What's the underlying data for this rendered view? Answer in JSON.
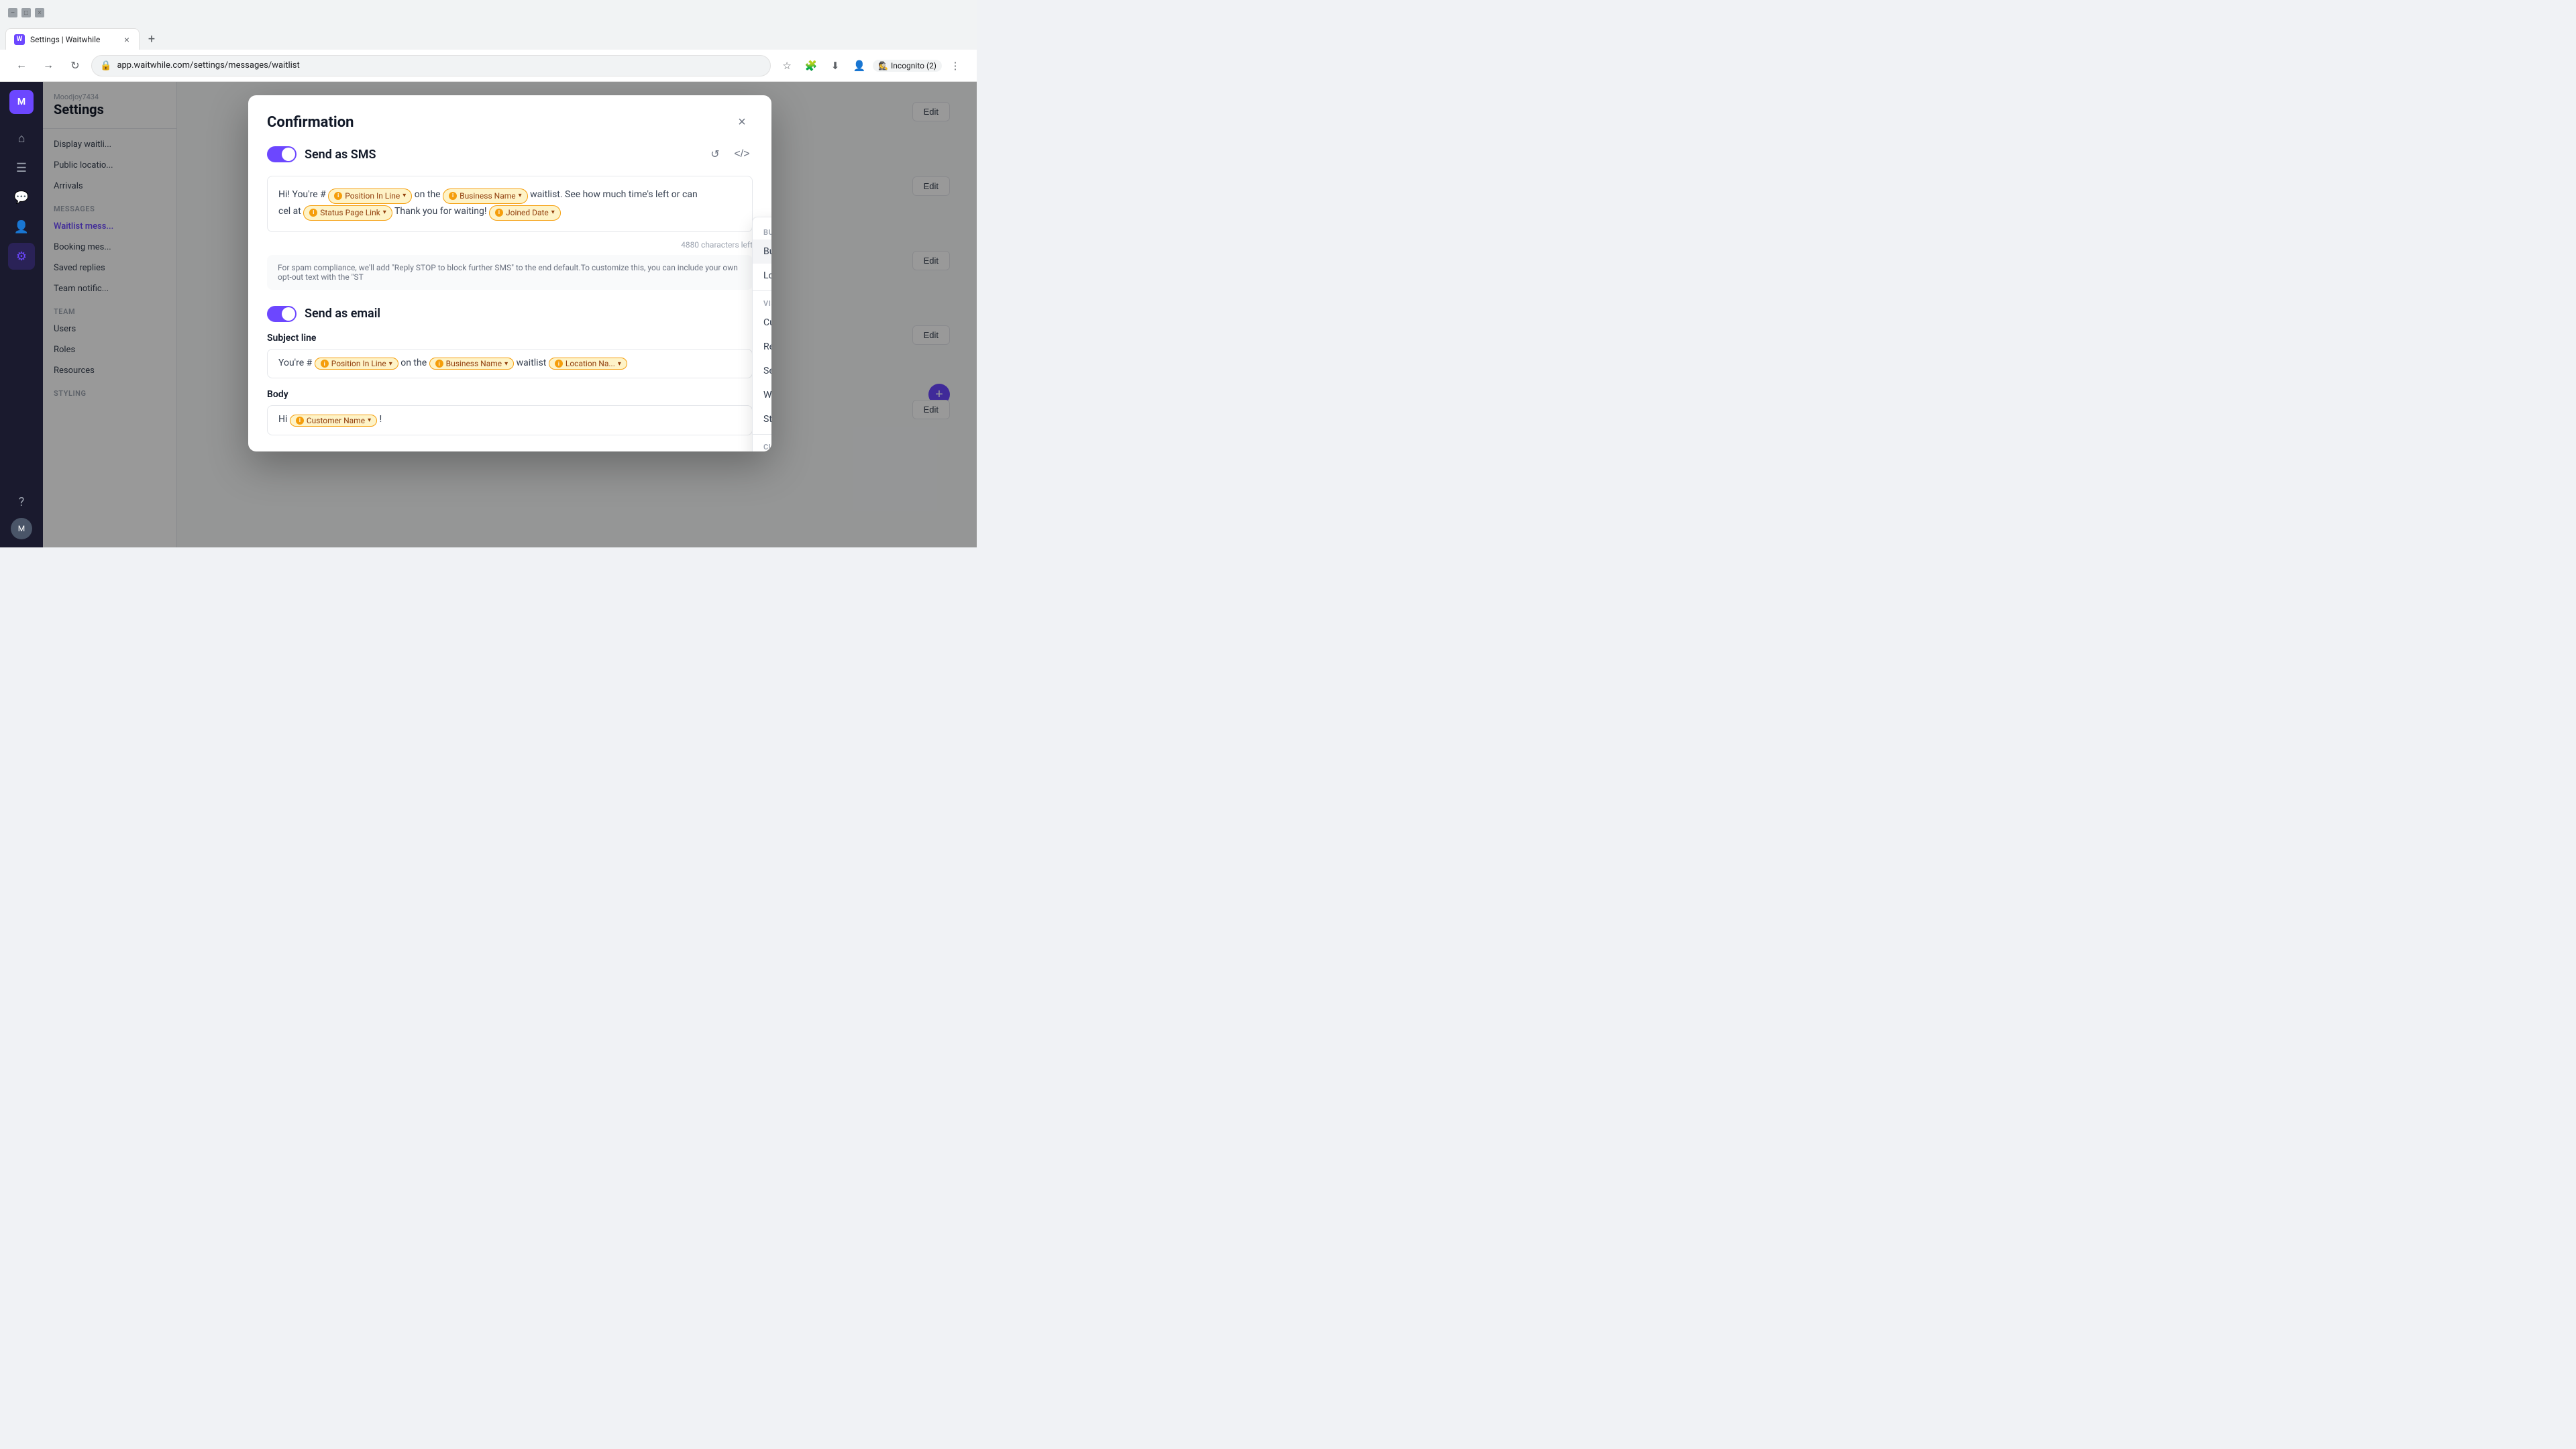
{
  "browser": {
    "tab_title": "Settings | Waitwhile",
    "address": "app.waitwhile.com/settings/messages/waitlist",
    "incognito_label": "Incognito (2)"
  },
  "sidebar": {
    "brand_initial": "M",
    "icons": [
      "⌂",
      "📋",
      "💬",
      "👤",
      "⚙"
    ],
    "user_initial": "M"
  },
  "settings_nav": {
    "brand_sub": "Moodjoy7434",
    "brand_title": "Settings",
    "items": [
      {
        "label": "Display waitli...",
        "active": false
      },
      {
        "label": "Public locatio...",
        "active": false
      },
      {
        "label": "Arrivals",
        "active": false
      }
    ],
    "sections": [
      {
        "title": "Messages",
        "items": [
          {
            "label": "Waitlist mess...",
            "active": true
          },
          {
            "label": "Booking mes...",
            "active": false
          },
          {
            "label": "Saved replies",
            "active": false
          },
          {
            "label": "Team notific...",
            "active": false
          }
        ]
      },
      {
        "title": "Team",
        "items": [
          {
            "label": "Users",
            "active": false
          },
          {
            "label": "Roles",
            "active": false
          },
          {
            "label": "Resources",
            "active": false
          }
        ]
      },
      {
        "title": "Styling",
        "items": []
      }
    ]
  },
  "modal": {
    "title": "Confirmation",
    "close_label": "×",
    "sms_section": {
      "toggle_on": true,
      "label": "Send as SMS",
      "reset_icon": "↺",
      "code_icon": "</>",
      "message_parts": [
        {
          "type": "text",
          "content": "Hi! You're # "
        },
        {
          "type": "tag",
          "label": "Position In Line"
        },
        {
          "type": "text",
          "content": " on the "
        },
        {
          "type": "tag",
          "label": "Business Name"
        },
        {
          "type": "text",
          "content": " waitlist. See how much time's left or can"
        },
        {
          "type": "text",
          "content": "cel at "
        },
        {
          "type": "tag",
          "label": "Status Page Link"
        },
        {
          "type": "text",
          "content": " Thank you for waiting! "
        },
        {
          "type": "tag",
          "label": "Joined Date"
        }
      ],
      "char_count": "4880 characters left",
      "spam_text": "For spam compliance, we'll add \"Reply STOP to block further SMS\" to the end default.To customize this, you can include your own opt-out text with the \"ST"
    },
    "email_section": {
      "toggle_on": true,
      "label": "Send as email",
      "subject_label": "Subject line",
      "subject_parts": [
        {
          "type": "text",
          "content": "You're # "
        },
        {
          "type": "tag",
          "label": "Position In Line"
        },
        {
          "type": "text",
          "content": " on the "
        },
        {
          "type": "tag",
          "label": "Business Name"
        },
        {
          "type": "text",
          "content": " waitlist "
        },
        {
          "type": "tag",
          "label": "Location Na..."
        }
      ],
      "body_label": "Body",
      "body_parts": [
        {
          "type": "text",
          "content": "Hi "
        },
        {
          "type": "tag",
          "label": "Customer Name"
        },
        {
          "type": "text",
          "content": " !"
        }
      ]
    }
  },
  "dropdown": {
    "business_section_title": "Business Attributes",
    "items": [
      {
        "label": "Business",
        "has_arrow": true,
        "hovered": true
      },
      {
        "label": "Location",
        "has_arrow": true
      }
    ],
    "visit_section_title": "Visit Attributes",
    "visit_items": [
      {
        "label": "Customer",
        "has_arrow": true
      },
      {
        "label": "Resource",
        "has_arrow": true
      },
      {
        "label": "Service",
        "has_arrow": true
      },
      {
        "label": "Waitlist",
        "has_arrow": true
      },
      {
        "label": "Status Page Link",
        "has_arrow": false
      }
    ],
    "custom_section_title": "Custom Attributes",
    "scrollbar_visible": true
  },
  "background_content": {
    "edit_buttons": [
      "Edit",
      "Edit",
      "Edit",
      "Edit",
      "Edit"
    ]
  }
}
